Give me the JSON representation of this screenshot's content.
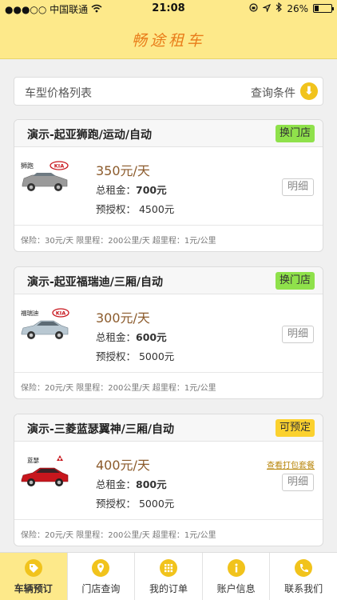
{
  "status_bar": {
    "carrier": "●●●○○ 中国联通",
    "time": "21:08",
    "battery": "26%",
    "battery_level": 0.26
  },
  "header": {
    "title": "畅途租车"
  },
  "filter": {
    "label": "车型价格列表",
    "condition": "查询条件"
  },
  "cars": [
    {
      "title": "演示-起亚狮跑/运动/自动",
      "badge": "换门店",
      "badge_color": "#8fe14b",
      "price": "350元/天",
      "total_label": "总租金：",
      "total_value": "700元",
      "preauth": "预授权：  4500元",
      "detail": "明细",
      "footer": "保险：30元/天 限里程：200公里/天 超里程：1元/公里",
      "car_color": "#9a9a9a",
      "plate": "狮跑",
      "brand": "KIA"
    },
    {
      "title": "演示-起亚福瑞迪/三厢/自动",
      "badge": "换门店",
      "badge_color": "#8fe14b",
      "price": "300元/天",
      "total_label": "总租金：",
      "total_value": "600元",
      "preauth": "预授权：  5000元",
      "detail": "明细",
      "footer": "保险：20元/天 限里程：200公里/天 超里程：1元/公里",
      "car_color": "#b9c8d2",
      "plate": "福瑞迪",
      "brand": "KIA"
    },
    {
      "title": "演示-三菱蓝瑟翼神/三厢/自动",
      "badge": "可预定",
      "badge_color": "#fbd12e",
      "price": "400元/天",
      "total_label": "总租金：",
      "total_value": "800元",
      "preauth": "预授权：  5000元",
      "detail": "明细",
      "package": "查看打包套餐",
      "footer": "保险：20元/天 限里程：200公里/天 超里程：1元/公里",
      "car_color": "#c8161d",
      "plate": "蓝瑟",
      "brand": "三菱"
    }
  ],
  "tabs": [
    {
      "label": "车辆预订",
      "icon": "tag-icon",
      "active": true
    },
    {
      "label": "门店查询",
      "icon": "location-icon",
      "active": false
    },
    {
      "label": "我的订单",
      "icon": "grid-icon",
      "active": false
    },
    {
      "label": "账户信息",
      "icon": "info-icon",
      "active": false
    },
    {
      "label": "联系我们",
      "icon": "phone-icon",
      "active": false
    }
  ]
}
